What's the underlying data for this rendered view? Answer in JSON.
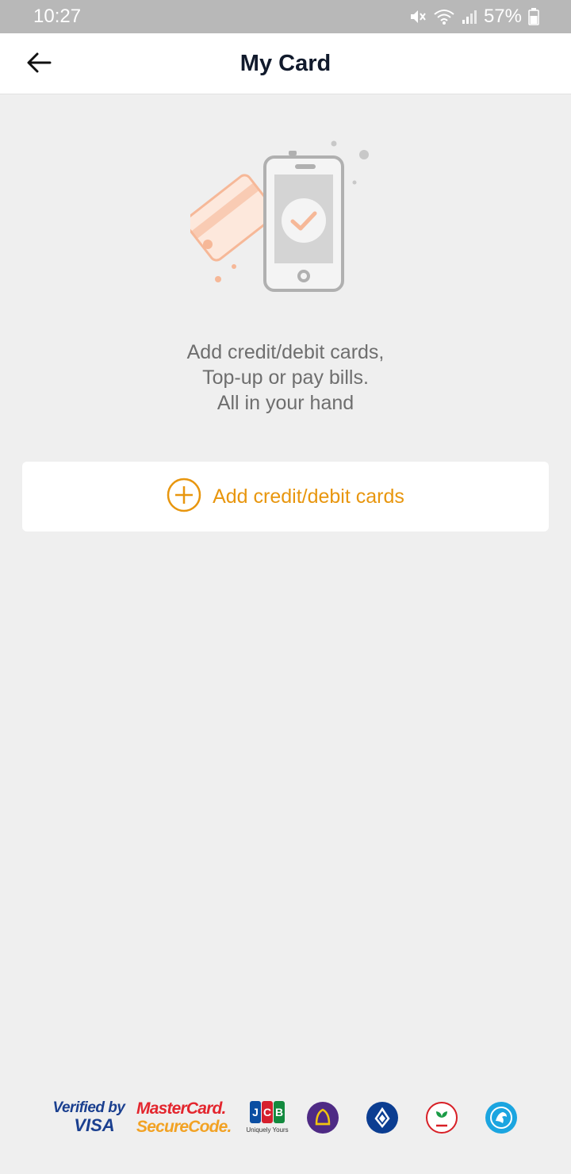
{
  "status_bar": {
    "time": "10:27",
    "battery_percent": "57%",
    "icons": [
      "mute-icon",
      "wifi-icon",
      "signal-icon",
      "battery-icon"
    ]
  },
  "app_bar": {
    "title": "My Card",
    "back_icon": "back-arrow-icon"
  },
  "empty_state": {
    "illustration": "phone-card-check-illustration",
    "line1": "Add credit/debit cards,",
    "line2": "Top-up or pay bills.",
    "line3": "All in your hand"
  },
  "add_card": {
    "label": "Add credit/debit cards",
    "icon": "plus-circle-icon"
  },
  "partners": {
    "verified_by": "Verified by",
    "visa": "VISA",
    "mastercard": "MasterCard.",
    "securecode": "SecureCode.",
    "jcb_tagline": "Uniquely Yours",
    "banks": [
      "scb-logo",
      "bangkok-bank-logo",
      "kasikorn-logo",
      "krungthai-logo"
    ]
  },
  "colors": {
    "accent": "#e8960e",
    "status_bar_bg": "#b8b8b8",
    "page_bg": "#efefef",
    "title": "#111a2c",
    "body_text": "#6e6e6e"
  }
}
